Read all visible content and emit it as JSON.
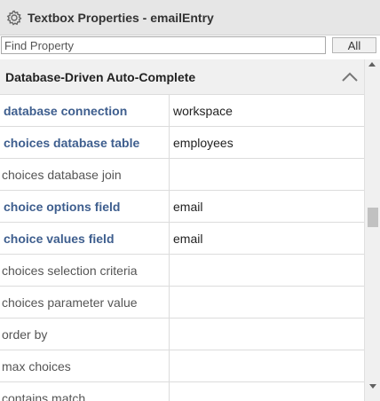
{
  "panel": {
    "title": "Textbox Properties - emailEntry",
    "icon": "gear-icon"
  },
  "search": {
    "placeholder": "Find Property",
    "value": "",
    "filter_button_label": "All"
  },
  "section": {
    "title": "Database-Driven Auto-Complete",
    "collapse_icon": "chevron-up-icon"
  },
  "properties": [
    {
      "name": "database connection",
      "value": "workspace",
      "set": true
    },
    {
      "name": "choices database table",
      "value": "employees",
      "set": true
    },
    {
      "name": "choices database join",
      "value": "",
      "set": false
    },
    {
      "name": "choice options field",
      "value": "email",
      "set": true
    },
    {
      "name": "choice values field",
      "value": "email",
      "set": true
    },
    {
      "name": "choices selection criteria",
      "value": "",
      "set": false
    },
    {
      "name": "choices parameter value",
      "value": "",
      "set": false
    },
    {
      "name": "order by",
      "value": "",
      "set": false
    },
    {
      "name": "max choices",
      "value": "",
      "set": false
    },
    {
      "name": "contains match",
      "value": "",
      "set": false
    }
  ],
  "colors": {
    "set_property_name": "#3e5e8e",
    "unset_property_name": "#555555",
    "header_background": "#e6e6e6"
  }
}
